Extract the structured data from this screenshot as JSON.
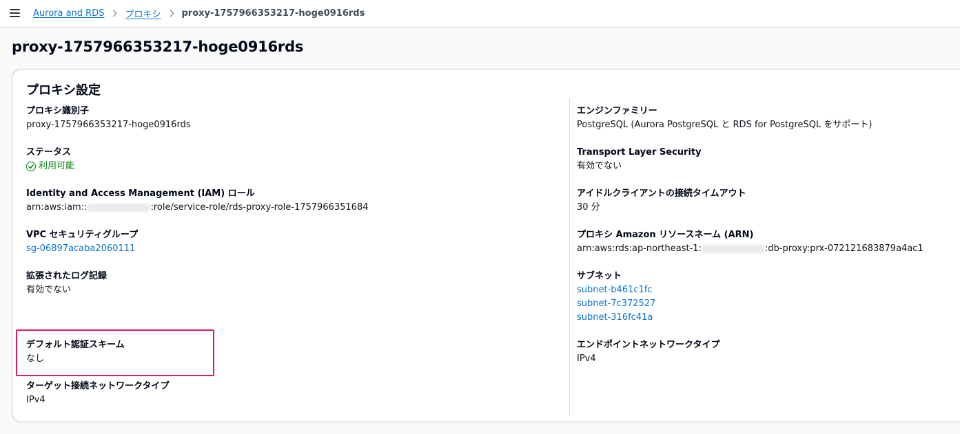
{
  "breadcrumb": {
    "items": [
      "Aurora and RDS",
      "プロキシ"
    ],
    "current": "proxy-1757966353217-hoge0916rds"
  },
  "page_title": "proxy-1757966353217-hoge0916rds",
  "panel": {
    "title": "プロキシ設定",
    "left": [
      {
        "label": "プロキシ識別子",
        "value": "proxy-1757966353217-hoge0916rds"
      },
      {
        "label": "ステータス",
        "value": "利用可能"
      },
      {
        "label": "Identity and Access Management (IAM) ロール",
        "value_prefix": "arn:aws:iam::",
        "value_suffix": ":role/service-role/rds-proxy-role-1757966351684"
      },
      {
        "label": "VPC セキュリティグループ",
        "value": "sg-06897acaba2060111"
      },
      {
        "label": "拡張されたログ記録",
        "value": "有効でない"
      },
      {
        "label": "デフォルト認証スキーム",
        "value": "なし"
      },
      {
        "label": "ターゲット接続ネットワークタイプ",
        "value": "IPv4"
      }
    ],
    "right": [
      {
        "label": "エンジンファミリー",
        "value": "PostgreSQL (Aurora PostgreSQL と RDS for PostgreSQL をサポート)"
      },
      {
        "label": "Transport Layer Security",
        "value": "有効でない"
      },
      {
        "label": "アイドルクライアントの接続タイムアウト",
        "value": "30 分"
      },
      {
        "label": "プロキシ Amazon リソースネーム (ARN)",
        "value_prefix": "arn:aws:rds:ap-northeast-1:",
        "value_suffix": ":db-proxy:prx-072121683879a4ac1"
      },
      {
        "label": "サブネット",
        "values": [
          "subnet-b461c1fc",
          "subnet-7c372527",
          "subnet-316fc41a"
        ]
      },
      {
        "label": "エンドポイントネットワークタイプ",
        "value": "IPv4"
      }
    ]
  },
  "colors": {
    "link": "#0972d3",
    "success": "#037f0c",
    "highlight": "#e0195f"
  }
}
